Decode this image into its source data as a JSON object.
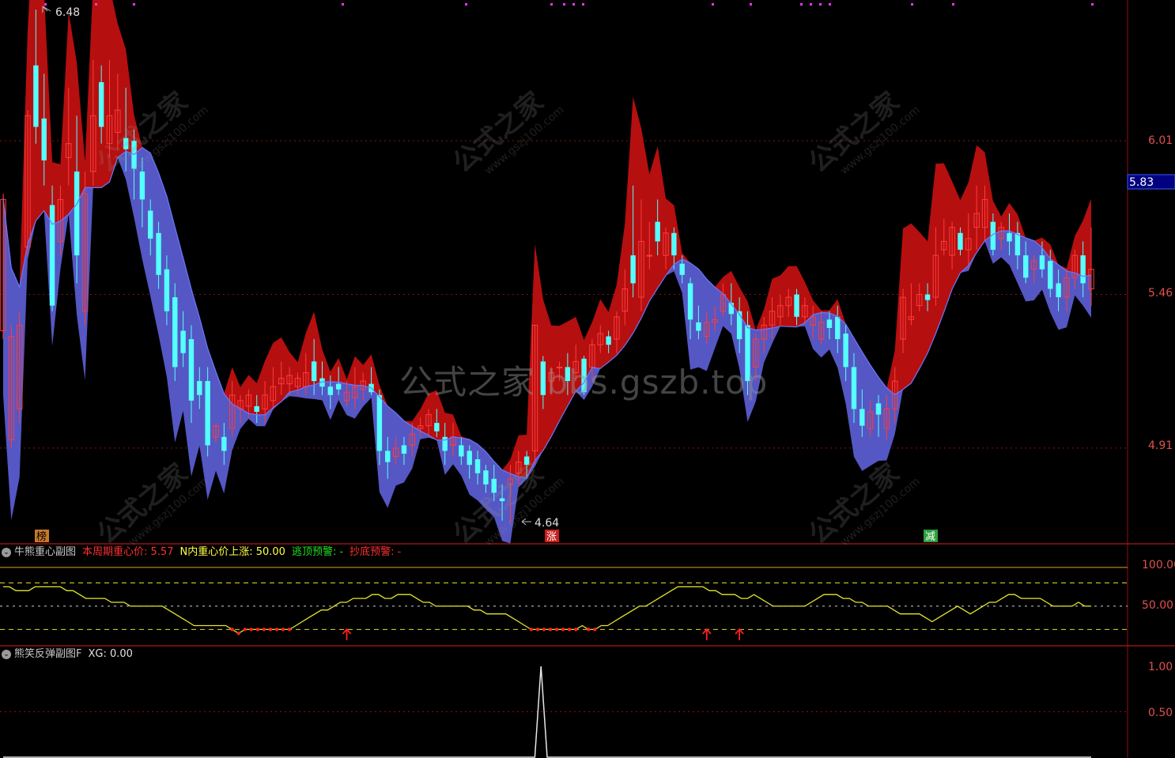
{
  "main_chart": {
    "price_labels": [
      "6.01",
      "5.46",
      "4.91"
    ],
    "current_price": "5.83",
    "high_marker": "6.48",
    "low_marker": "4.64",
    "signal_labels": [
      {
        "text": "榜",
        "color": "#c8782a"
      },
      {
        "text": "涨",
        "color": "#c81e1e"
      },
      {
        "text": "减",
        "color": "#2e9e3e"
      }
    ]
  },
  "panel_gravity": {
    "title": "牛熊重心副图",
    "items": [
      {
        "label": "本周期重心价: 5.57",
        "color": "#ff3030"
      },
      {
        "label": "N内重心价上涨: 50.00",
        "color": "#ffff40"
      },
      {
        "label": "逃顶预警: -",
        "color": "#20e020"
      },
      {
        "label": "抄底预警: -",
        "color": "#ff3030"
      }
    ],
    "y_labels": [
      "100.00",
      "50.00"
    ]
  },
  "panel_rebound": {
    "title": "熊笑反弹副图F",
    "items": [
      {
        "label": "XG: 0.00",
        "color": "#e0e0e0"
      }
    ],
    "y_labels": [
      "1.00",
      "0.50"
    ]
  },
  "watermarks": {
    "center": "公式之家 bbs.gszb.top",
    "cn": "公式之家",
    "url": "www.gszj100.com"
  },
  "chart_data": [
    {
      "type": "candlestick",
      "panel": "main",
      "y_ticks": [
        6.01,
        5.46,
        4.91
      ],
      "ylim": [
        4.59,
        6.5
      ],
      "last_price": 5.83,
      "high": 6.48,
      "low": 4.64,
      "candles": [
        [
          5.33,
          5.8,
          5.3,
          5.82
        ],
        [
          4.94,
          5.31,
          4.91,
          5.35
        ],
        [
          5.05,
          5.35,
          5.0,
          5.4
        ],
        [
          5.63,
          6.1,
          5.6,
          6.12
        ],
        [
          6.28,
          6.06,
          6.0,
          6.48
        ],
        [
          6.09,
          5.94,
          5.85,
          6.25
        ],
        [
          5.78,
          5.42,
          5.4,
          5.85
        ],
        [
          5.65,
          5.8,
          5.6,
          5.85
        ],
        [
          5.95,
          6.0,
          5.85,
          6.2
        ],
        [
          5.9,
          5.6,
          5.5,
          6.1
        ],
        [
          5.4,
          5.82,
          5.35,
          5.9
        ],
        [
          5.9,
          6.1,
          5.85,
          6.3
        ],
        [
          6.22,
          6.06,
          6.0,
          6.28
        ],
        [
          6.0,
          6.1,
          5.95,
          6.3
        ],
        [
          6.04,
          6.12,
          5.98,
          6.25
        ],
        [
          6.02,
          5.98,
          5.9,
          6.2
        ],
        [
          6.01,
          5.91,
          5.8,
          6.05
        ],
        [
          5.9,
          5.8,
          5.7,
          5.95
        ],
        [
          5.76,
          5.66,
          5.6,
          5.8
        ],
        [
          5.68,
          5.53,
          5.48,
          5.72
        ],
        [
          5.55,
          5.4,
          5.35,
          5.6
        ],
        [
          5.45,
          5.2,
          5.15,
          5.5
        ],
        [
          5.33,
          5.25,
          5.2,
          5.4
        ],
        [
          5.3,
          5.08,
          5.0,
          5.35
        ],
        [
          5.15,
          5.1,
          5.05,
          5.2
        ],
        [
          5.15,
          4.92,
          4.88,
          5.2
        ],
        [
          4.95,
          4.99,
          4.93,
          5.0
        ],
        [
          4.95,
          4.9,
          4.85,
          5.0
        ],
        [
          4.98,
          5.1,
          4.95,
          5.15
        ],
        [
          5.05,
          5.08,
          5.0,
          5.1
        ],
        [
          5.06,
          5.1,
          5.02,
          5.12
        ],
        [
          5.06,
          5.04,
          5.0,
          5.1
        ],
        [
          5.05,
          5.1,
          5.0,
          5.15
        ],
        [
          5.08,
          5.13,
          5.05,
          5.2
        ],
        [
          5.14,
          5.16,
          5.1,
          5.22
        ],
        [
          5.14,
          5.17,
          5.1,
          5.2
        ],
        [
          5.13,
          5.16,
          5.1,
          5.18
        ],
        [
          5.13,
          5.18,
          5.1,
          5.25
        ],
        [
          5.22,
          5.15,
          5.1,
          5.3
        ],
        [
          5.16,
          5.13,
          5.1,
          5.22
        ],
        [
          5.13,
          5.1,
          5.05,
          5.17
        ],
        [
          5.14,
          5.12,
          5.1,
          5.2
        ],
        [
          5.08,
          5.11,
          5.06,
          5.15
        ],
        [
          5.09,
          5.13,
          5.05,
          5.2
        ],
        [
          5.12,
          5.15,
          5.08,
          5.18
        ],
        [
          5.14,
          5.11,
          5.1,
          5.2
        ],
        [
          5.1,
          4.9,
          4.85,
          5.12
        ],
        [
          4.9,
          4.86,
          4.8,
          4.95
        ],
        [
          4.88,
          4.91,
          4.85,
          4.95
        ],
        [
          4.92,
          4.89,
          4.85,
          4.95
        ],
        [
          4.92,
          4.96,
          4.88,
          5.0
        ],
        [
          4.98,
          4.99,
          4.95,
          5.02
        ],
        [
          4.99,
          5.03,
          4.95,
          5.05
        ],
        [
          5.0,
          4.97,
          4.95,
          5.05
        ],
        [
          4.95,
          4.9,
          4.85,
          5.0
        ],
        [
          4.92,
          4.95,
          4.88,
          5.0
        ],
        [
          4.92,
          4.88,
          4.85,
          4.95
        ],
        [
          4.9,
          4.85,
          4.8,
          4.92
        ],
        [
          4.87,
          4.82,
          4.78,
          4.9
        ],
        [
          4.83,
          4.78,
          4.75,
          4.85
        ],
        [
          4.8,
          4.75,
          4.72,
          4.85
        ],
        [
          4.73,
          4.72,
          4.65,
          4.78
        ],
        [
          4.78,
          4.8,
          4.64,
          4.85
        ],
        [
          4.82,
          4.86,
          4.78,
          4.9
        ],
        [
          4.88,
          4.85,
          4.8,
          4.9
        ],
        [
          4.9,
          5.35,
          4.85,
          5.35
        ],
        [
          5.22,
          5.1,
          5.05,
          5.24
        ],
        [
          5.15,
          5.18,
          5.1,
          5.2
        ],
        [
          5.2,
          5.2,
          5.15,
          5.22
        ],
        [
          5.2,
          5.15,
          5.1,
          5.25
        ],
        [
          5.18,
          5.22,
          5.15,
          5.28
        ],
        [
          5.23,
          5.11,
          5.1,
          5.24
        ],
        [
          5.2,
          5.28,
          5.15,
          5.3
        ],
        [
          5.28,
          5.32,
          5.25,
          5.35
        ],
        [
          5.31,
          5.28,
          5.25,
          5.33
        ],
        [
          5.3,
          5.38,
          5.25,
          5.4
        ],
        [
          5.4,
          5.48,
          5.35,
          5.55
        ],
        [
          5.6,
          5.5,
          5.45,
          5.85
        ],
        [
          5.45,
          5.65,
          5.4,
          5.8
        ],
        [
          5.6,
          5.6,
          5.55,
          5.72
        ],
        [
          5.72,
          5.65,
          5.6,
          5.8
        ],
        [
          5.6,
          5.68,
          5.55,
          5.7
        ],
        [
          5.68,
          5.6,
          5.55,
          5.7
        ],
        [
          5.57,
          5.53,
          5.5,
          5.6
        ],
        [
          5.5,
          5.37,
          5.3,
          5.52
        ],
        [
          5.36,
          5.33,
          5.3,
          5.42
        ],
        [
          5.31,
          5.36,
          5.28,
          5.4
        ],
        [
          5.36,
          5.37,
          5.33,
          5.42
        ],
        [
          5.4,
          5.46,
          5.38,
          5.5
        ],
        [
          5.43,
          5.39,
          5.35,
          5.5
        ],
        [
          5.4,
          5.3,
          5.25,
          5.45
        ],
        [
          5.35,
          5.15,
          5.1,
          5.4
        ],
        [
          5.2,
          5.3,
          5.15,
          5.32
        ],
        [
          5.3,
          5.35,
          5.25,
          5.38
        ],
        [
          5.35,
          5.4,
          5.3,
          5.45
        ],
        [
          5.38,
          5.42,
          5.35,
          5.46
        ],
        [
          5.42,
          5.45,
          5.38,
          5.48
        ],
        [
          5.46,
          5.38,
          5.35,
          5.48
        ],
        [
          5.38,
          5.42,
          5.35,
          5.45
        ],
        [
          5.35,
          5.38,
          5.3,
          5.42
        ],
        [
          5.3,
          5.36,
          5.28,
          5.4
        ],
        [
          5.37,
          5.34,
          5.3,
          5.4
        ],
        [
          5.38,
          5.3,
          5.25,
          5.42
        ],
        [
          5.32,
          5.2,
          5.15,
          5.35
        ],
        [
          5.2,
          5.05,
          5.0,
          5.25
        ],
        [
          5.05,
          4.99,
          4.95,
          5.12
        ],
        [
          4.98,
          5.04,
          4.95,
          5.08
        ],
        [
          5.07,
          5.03,
          4.95,
          5.1
        ],
        [
          4.98,
          5.05,
          4.94,
          5.1
        ],
        [
          5.05,
          5.15,
          5.0,
          5.2
        ],
        [
          5.3,
          5.45,
          5.25,
          5.48
        ],
        [
          5.37,
          5.38,
          5.35,
          5.5
        ],
        [
          5.42,
          5.46,
          5.4,
          5.5
        ],
        [
          5.46,
          5.44,
          5.4,
          5.5
        ],
        [
          5.45,
          5.6,
          5.42,
          5.7
        ],
        [
          5.62,
          5.65,
          5.6,
          5.73
        ],
        [
          5.6,
          5.7,
          5.55,
          5.72
        ],
        [
          5.68,
          5.62,
          5.6,
          5.7
        ],
        [
          5.62,
          5.66,
          5.55,
          5.75
        ],
        [
          5.7,
          5.75,
          5.62,
          5.85
        ],
        [
          5.7,
          5.8,
          5.65,
          5.85
        ],
        [
          5.72,
          5.62,
          5.6,
          5.75
        ],
        [
          5.66,
          5.7,
          5.62,
          5.72
        ],
        [
          5.68,
          5.65,
          5.6,
          5.75
        ],
        [
          5.68,
          5.6,
          5.55,
          5.72
        ],
        [
          5.6,
          5.52,
          5.5,
          5.65
        ],
        [
          5.55,
          5.58,
          5.5,
          5.6
        ],
        [
          5.6,
          5.55,
          5.52,
          5.65
        ],
        [
          5.58,
          5.48,
          5.45,
          5.62
        ],
        [
          5.5,
          5.45,
          5.4,
          5.55
        ],
        [
          5.45,
          5.52,
          5.4,
          5.55
        ],
        [
          5.52,
          5.6,
          5.48,
          5.62
        ],
        [
          5.6,
          5.5,
          5.45,
          5.65
        ],
        [
          5.48,
          5.55,
          5.42,
          5.7
        ]
      ]
    },
    {
      "type": "line",
      "panel": "gravity",
      "y_ticks": [
        100,
        50
      ],
      "reference_levels": [
        100,
        80,
        50,
        20
      ],
      "ylim": [
        0,
        110
      ],
      "series": [
        {
          "values": [
            75,
            75,
            70,
            70,
            70,
            75,
            75,
            75,
            75,
            75,
            70,
            70,
            65,
            60,
            60,
            60,
            60,
            55,
            55,
            55,
            50,
            50,
            50,
            50,
            50,
            50,
            45,
            40,
            35,
            30,
            25,
            25,
            25,
            25,
            25,
            25,
            20,
            15,
            20,
            20,
            20,
            20,
            20,
            20,
            20,
            20,
            25,
            30,
            35,
            40,
            45,
            45,
            50,
            55,
            55,
            60,
            60,
            60,
            65,
            65,
            60,
            60,
            65,
            65,
            65,
            60,
            55,
            55,
            50,
            50,
            50,
            50,
            50,
            50,
            45,
            45,
            40,
            40,
            40,
            40,
            35,
            30,
            25,
            20,
            20,
            20,
            20,
            20,
            20,
            20,
            20,
            25,
            20,
            20,
            25,
            25,
            30,
            35,
            40,
            45,
            50,
            50,
            55,
            60,
            65,
            70,
            75,
            75,
            75,
            75,
            75,
            70,
            70,
            65,
            65,
            65,
            60,
            60,
            65,
            60,
            55,
            50,
            50,
            50,
            50,
            50,
            50,
            55,
            60,
            65,
            65,
            65,
            60,
            60,
            55,
            55,
            50,
            50,
            50,
            50,
            45,
            40,
            40,
            40,
            40,
            35,
            30,
            35,
            40,
            45,
            50,
            45,
            40,
            45,
            50,
            55,
            55,
            60,
            65,
            65,
            60,
            60,
            60,
            60,
            55,
            50,
            50,
            50,
            50,
            55,
            50,
            50
          ]
        }
      ],
      "markers": [
        {
          "type": "arrow-up",
          "index": 42
        },
        {
          "type": "arrow-up",
          "index": 86
        },
        {
          "type": "arrow-up",
          "index": 90
        }
      ]
    },
    {
      "type": "line",
      "panel": "rebound",
      "y_ticks": [
        1.0,
        0.5
      ],
      "ylim": [
        0,
        1.0
      ],
      "series": [
        {
          "name": "XG",
          "values": [
            0,
            0,
            0,
            0,
            0,
            0,
            0,
            0,
            0,
            0,
            0,
            0,
            0,
            0,
            0,
            0,
            0,
            0,
            0,
            0,
            0,
            0,
            0,
            0,
            0,
            0,
            0,
            0,
            0,
            0,
            0,
            0,
            0,
            0,
            0,
            0,
            0,
            0,
            0,
            0,
            0,
            0,
            0,
            0,
            0,
            0,
            0,
            0,
            0,
            0,
            0,
            0,
            0,
            0,
            0,
            0,
            0,
            0,
            0,
            0,
            0,
            0,
            0,
            0,
            0,
            0,
            0,
            0,
            0,
            0,
            0,
            0,
            0,
            0,
            0,
            0,
            0,
            0,
            0,
            0,
            0,
            0,
            0,
            0,
            0,
            0,
            0,
            1,
            0,
            0,
            0,
            0,
            0,
            0,
            0,
            0,
            0,
            0,
            0,
            0,
            0,
            0,
            0,
            0,
            0,
            0,
            0,
            0,
            0,
            0,
            0,
            0,
            0,
            0,
            0,
            0,
            0,
            0,
            0,
            0,
            0,
            0,
            0,
            0,
            0,
            0,
            0,
            0,
            0,
            0,
            0,
            0,
            0,
            0,
            0,
            0,
            0,
            0,
            0,
            0,
            0,
            0,
            0,
            0,
            0,
            0,
            0,
            0,
            0,
            0,
            0,
            0,
            0,
            0,
            0,
            0,
            0,
            0,
            0,
            0,
            0,
            0,
            0,
            0,
            0,
            0,
            0,
            0,
            0,
            0,
            0,
            0,
            0,
            0,
            0,
            0,
            0
          ]
        }
      ]
    }
  ]
}
